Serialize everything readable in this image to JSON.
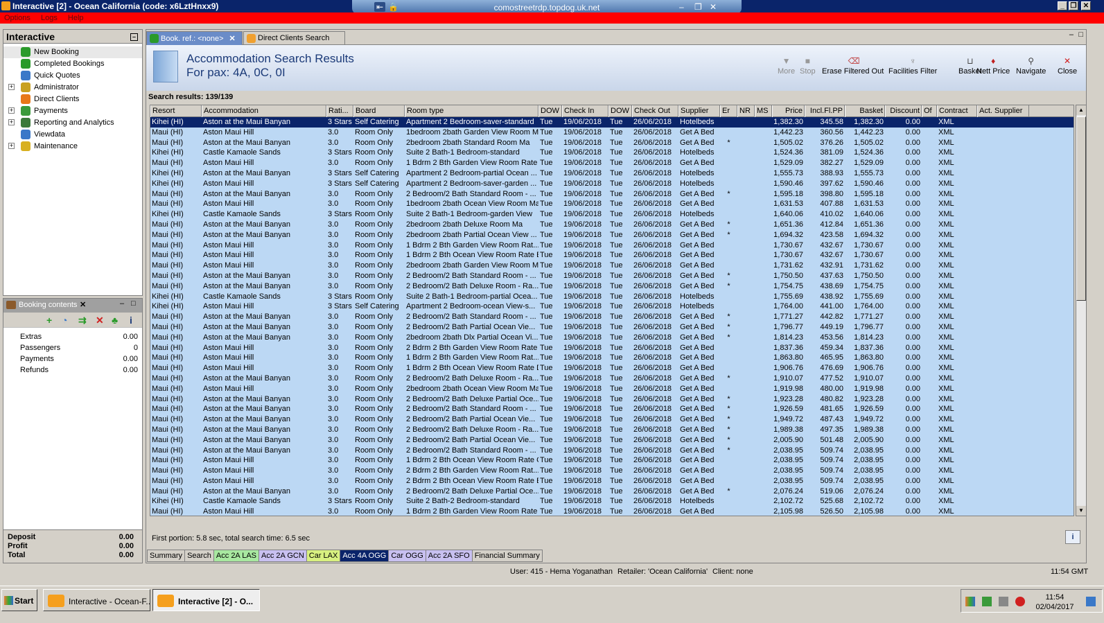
{
  "window": {
    "title": "Interactive [2] - Ocean California (code: x6LztHnxx9)",
    "remote_host": "comostreetrdp.topdog.uk.net"
  },
  "menu": [
    "Options",
    "Logs",
    "Help"
  ],
  "nav": {
    "title": "Interactive",
    "items": [
      {
        "label": "New Booking",
        "expandable": false,
        "icon": "palm-tree-icon",
        "color": "#2a9a2a"
      },
      {
        "label": "Completed Bookings",
        "expandable": false,
        "icon": "palm-tree-icon",
        "color": "#2a9a2a"
      },
      {
        "label": "Quick Quotes",
        "expandable": false,
        "icon": "clock-icon",
        "color": "#3a78c8"
      },
      {
        "label": "Administrator",
        "expandable": true,
        "icon": "person-icon",
        "color": "#c8a020"
      },
      {
        "label": "Direct Clients",
        "expandable": false,
        "icon": "star-icon",
        "color": "#e87818"
      },
      {
        "label": "Payments",
        "expandable": true,
        "icon": "payments-icon",
        "color": "#3a9a3a"
      },
      {
        "label": "Reporting and Analytics",
        "expandable": true,
        "icon": "report-icon",
        "color": "#3a7a3a"
      },
      {
        "label": "Viewdata",
        "expandable": false,
        "icon": "globe-icon",
        "color": "#3a78c8"
      },
      {
        "label": "Maintenance",
        "expandable": true,
        "icon": "toolbox-icon",
        "color": "#d8b020"
      }
    ]
  },
  "booking": {
    "title": "Booking contents",
    "rows": [
      {
        "label": "Extras",
        "value": "0.00"
      },
      {
        "label": "Passengers",
        "value": "0"
      },
      {
        "label": "Payments",
        "value": "0.00"
      },
      {
        "label": "Refunds",
        "value": "0.00"
      }
    ],
    "totals": [
      {
        "label": "Deposit",
        "value": "0.00"
      },
      {
        "label": "Profit",
        "value": "0.00"
      },
      {
        "label": "Total",
        "value": "0.00"
      }
    ]
  },
  "tabs": [
    {
      "label": "Book. ref.: <none>",
      "active": true
    },
    {
      "label": "Direct Clients Search",
      "active": false
    }
  ],
  "results": {
    "title": "Accommodation Search Results",
    "subtitle": "For pax: 4A, 0C, 0I",
    "count": "Search results: 139/139",
    "timing": "First portion: 5.8 sec, total search time: 6.5 sec"
  },
  "toolbar": [
    {
      "label": "More",
      "icon": "funnel-icon",
      "disabled": true
    },
    {
      "label": "Stop",
      "icon": "stop-icon",
      "disabled": true
    },
    {
      "label": "Erase Filtered Out",
      "icon": "erase-icon",
      "disabled": false
    },
    {
      "label": "Facilities Filter",
      "icon": "filter-icon",
      "disabled": false
    },
    {
      "label": "Basket",
      "icon": "basket-icon",
      "disabled": false
    },
    {
      "label": "Nett Price",
      "icon": "price-icon",
      "disabled": false
    },
    {
      "label": "Navigate",
      "icon": "navigate-icon",
      "disabled": false
    },
    {
      "label": "Close",
      "icon": "close-icon",
      "disabled": false
    }
  ],
  "columns": [
    "Resort",
    "Accommodation",
    "Rati...",
    "Board",
    "Room type",
    "DOW",
    "Check In",
    "DOW",
    "Check Out",
    "Supplier",
    "Er",
    "NR",
    "MS",
    "Price",
    "Incl.Fl.PP",
    "Basket",
    "Discount",
    "Of",
    "Contract",
    "Act. Supplier"
  ],
  "rows": [
    [
      "Kihei (HI)",
      "Aston at the Maui Banyan",
      "3 Stars",
      "Self Catering",
      "Apartment 2 Bedroom-saver-standard",
      "Tue",
      "19/06/2018",
      "Tue",
      "26/06/2018",
      "Hotelbeds",
      "",
      "",
      "",
      "1,382.30",
      "345.58",
      "1,382.30",
      "0.00",
      "",
      "XML",
      ""
    ],
    [
      "Maui (HI)",
      "Aston Maui Hill",
      "3.0",
      "Room Only",
      "1bedroom 2bath Garden View Room Ma",
      "Tue",
      "19/06/2018",
      "Tue",
      "26/06/2018",
      "Get A Bed",
      "",
      "",
      "",
      "1,442.23",
      "360.56",
      "1,442.23",
      "0.00",
      "",
      "XML",
      ""
    ],
    [
      "Maui (HI)",
      "Aston at the Maui Banyan",
      "3.0",
      "Room Only",
      "2bedroom 2bath Standard Room Ma",
      "Tue",
      "19/06/2018",
      "Tue",
      "26/06/2018",
      "Get A Bed",
      "*",
      "",
      "",
      "1,505.02",
      "376.26",
      "1,505.02",
      "0.00",
      "",
      "XML",
      ""
    ],
    [
      "Kihei (HI)",
      "Castle Kamaole Sands",
      "3 Stars",
      "Room Only",
      "Suite 2 Bath-1 Bedroom-standard",
      "Tue",
      "19/06/2018",
      "Tue",
      "26/06/2018",
      "Hotelbeds",
      "",
      "",
      "",
      "1,524.36",
      "381.09",
      "1,524.36",
      "0.00",
      "",
      "XML",
      ""
    ],
    [
      "Maui (HI)",
      "Aston Maui Hill",
      "3.0",
      "Room Only",
      "1 Bdrm 2 Bth Garden View Room Rate E",
      "Tue",
      "19/06/2018",
      "Tue",
      "26/06/2018",
      "Get A Bed",
      "",
      "",
      "",
      "1,529.09",
      "382.27",
      "1,529.09",
      "0.00",
      "",
      "XML",
      ""
    ],
    [
      "Kihei (HI)",
      "Aston at the Maui Banyan",
      "3 Stars",
      "Self Catering",
      "Apartment 2 Bedroom-partial Ocean ...",
      "Tue",
      "19/06/2018",
      "Tue",
      "26/06/2018",
      "Hotelbeds",
      "",
      "",
      "",
      "1,555.73",
      "388.93",
      "1,555.73",
      "0.00",
      "",
      "XML",
      ""
    ],
    [
      "Kihei (HI)",
      "Aston Maui Hill",
      "3 Stars",
      "Self Catering",
      "Apartment 2 Bedroom-saver-garden ...",
      "Tue",
      "19/06/2018",
      "Tue",
      "26/06/2018",
      "Hotelbeds",
      "",
      "",
      "",
      "1,590.46",
      "397.62",
      "1,590.46",
      "0.00",
      "",
      "XML",
      ""
    ],
    [
      "Maui (HI)",
      "Aston at the Maui Banyan",
      "3.0",
      "Room Only",
      "2 Bedroom/2 Bath Standard Room - ...",
      "Tue",
      "19/06/2018",
      "Tue",
      "26/06/2018",
      "Get A Bed",
      "*",
      "",
      "",
      "1,595.18",
      "398.80",
      "1,595.18",
      "0.00",
      "",
      "XML",
      ""
    ],
    [
      "Maui (HI)",
      "Aston Maui Hill",
      "3.0",
      "Room Only",
      "1bedroom 2bath Ocean View Room Ma",
      "Tue",
      "19/06/2018",
      "Tue",
      "26/06/2018",
      "Get A Bed",
      "",
      "",
      "",
      "1,631.53",
      "407.88",
      "1,631.53",
      "0.00",
      "",
      "XML",
      ""
    ],
    [
      "Kihei (HI)",
      "Castle Kamaole Sands",
      "3 Stars",
      "Room Only",
      "Suite 2 Bath-1 Bedroom-garden View",
      "Tue",
      "19/06/2018",
      "Tue",
      "26/06/2018",
      "Hotelbeds",
      "",
      "",
      "",
      "1,640.06",
      "410.02",
      "1,640.06",
      "0.00",
      "",
      "XML",
      ""
    ],
    [
      "Maui (HI)",
      "Aston at the Maui Banyan",
      "3.0",
      "Room Only",
      "2bedroom 2bath Deluxe  Room Ma",
      "Tue",
      "19/06/2018",
      "Tue",
      "26/06/2018",
      "Get A Bed",
      "*",
      "",
      "",
      "1,651.36",
      "412.84",
      "1,651.36",
      "0.00",
      "",
      "XML",
      ""
    ],
    [
      "Maui (HI)",
      "Aston at the Maui Banyan",
      "3.0",
      "Room Only",
      "2bedroom 2bath Partial Ocean View ...",
      "Tue",
      "19/06/2018",
      "Tue",
      "26/06/2018",
      "Get A Bed",
      "*",
      "",
      "",
      "1,694.32",
      "423.58",
      "1,694.32",
      "0.00",
      "",
      "XML",
      ""
    ],
    [
      "Maui (HI)",
      "Aston Maui Hill",
      "3.0",
      "Room Only",
      "1 Bdrm 2 Bth Garden View Room Rat...",
      "Tue",
      "19/06/2018",
      "Tue",
      "26/06/2018",
      "Get A Bed",
      "",
      "",
      "",
      "1,730.67",
      "432.67",
      "1,730.67",
      "0.00",
      "",
      "XML",
      ""
    ],
    [
      "Maui (HI)",
      "Aston Maui Hill",
      "3.0",
      "Room Only",
      "1 Bdrm 2 Bth Ocean View Room Rate E",
      "Tue",
      "19/06/2018",
      "Tue",
      "26/06/2018",
      "Get A Bed",
      "",
      "",
      "",
      "1,730.67",
      "432.67",
      "1,730.67",
      "0.00",
      "",
      "XML",
      ""
    ],
    [
      "Maui (HI)",
      "Aston Maui Hill",
      "3.0",
      "Room Only",
      "2bedroom 2bath Garden View Room Ma",
      "Tue",
      "19/06/2018",
      "Tue",
      "26/06/2018",
      "Get A Bed",
      "",
      "",
      "",
      "1,731.62",
      "432.91",
      "1,731.62",
      "0.00",
      "",
      "XML",
      ""
    ],
    [
      "Maui (HI)",
      "Aston at the Maui Banyan",
      "3.0",
      "Room Only",
      "2 Bedroom/2 Bath Standard Room - ...",
      "Tue",
      "19/06/2018",
      "Tue",
      "26/06/2018",
      "Get A Bed",
      "*",
      "",
      "",
      "1,750.50",
      "437.63",
      "1,750.50",
      "0.00",
      "",
      "XML",
      ""
    ],
    [
      "Maui (HI)",
      "Aston at the Maui Banyan",
      "3.0",
      "Room Only",
      "2 Bedroom/2 Bath Deluxe Room - Ra...",
      "Tue",
      "19/06/2018",
      "Tue",
      "26/06/2018",
      "Get A Bed",
      "*",
      "",
      "",
      "1,754.75",
      "438.69",
      "1,754.75",
      "0.00",
      "",
      "XML",
      ""
    ],
    [
      "Kihei (HI)",
      "Castle Kamaole Sands",
      "3 Stars",
      "Room Only",
      "Suite 2 Bath-1 Bedroom-partial Ocea...",
      "Tue",
      "19/06/2018",
      "Tue",
      "26/06/2018",
      "Hotelbeds",
      "",
      "",
      "",
      "1,755.69",
      "438.92",
      "1,755.69",
      "0.00",
      "",
      "XML",
      ""
    ],
    [
      "Kihei (HI)",
      "Aston Maui Hill",
      "3 Stars",
      "Self Catering",
      "Apartment 2 Bedroom-ocean View-s...",
      "Tue",
      "19/06/2018",
      "Tue",
      "26/06/2018",
      "Hotelbeds",
      "",
      "",
      "",
      "1,764.00",
      "441.00",
      "1,764.00",
      "0.00",
      "",
      "XML",
      ""
    ],
    [
      "Maui (HI)",
      "Aston at the Maui Banyan",
      "3.0",
      "Room Only",
      "2 Bedroom/2 Bath Standard Room - ...",
      "Tue",
      "19/06/2018",
      "Tue",
      "26/06/2018",
      "Get A Bed",
      "*",
      "",
      "",
      "1,771.27",
      "442.82",
      "1,771.27",
      "0.00",
      "",
      "XML",
      ""
    ],
    [
      "Maui (HI)",
      "Aston at the Maui Banyan",
      "3.0",
      "Room Only",
      "2 Bedroom/2 Bath Partial Ocean Vie...",
      "Tue",
      "19/06/2018",
      "Tue",
      "26/06/2018",
      "Get A Bed",
      "*",
      "",
      "",
      "1,796.77",
      "449.19",
      "1,796.77",
      "0.00",
      "",
      "XML",
      ""
    ],
    [
      "Maui (HI)",
      "Aston at the Maui Banyan",
      "3.0",
      "Room Only",
      "2bedroom 2bath Dlx Partial Ocean Vi...",
      "Tue",
      "19/06/2018",
      "Tue",
      "26/06/2018",
      "Get A Bed",
      "*",
      "",
      "",
      "1,814.23",
      "453.56",
      "1,814.23",
      "0.00",
      "",
      "XML",
      ""
    ],
    [
      "Maui (HI)",
      "Aston Maui Hill",
      "3.0",
      "Room Only",
      "2 Bdrm 2 Bth Garden View Room Rate E",
      "Tue",
      "19/06/2018",
      "Tue",
      "26/06/2018",
      "Get A Bed",
      "",
      "",
      "",
      "1,837.36",
      "459.34",
      "1,837.36",
      "0.00",
      "",
      "XML",
      ""
    ],
    [
      "Maui (HI)",
      "Aston Maui Hill",
      "3.0",
      "Room Only",
      "1 Bdrm 2 Bth Garden View Room Rat...",
      "Tue",
      "19/06/2018",
      "Tue",
      "26/06/2018",
      "Get A Bed",
      "",
      "",
      "",
      "1,863.80",
      "465.95",
      "1,863.80",
      "0.00",
      "",
      "XML",
      ""
    ],
    [
      "Maui (HI)",
      "Aston Maui Hill",
      "3.0",
      "Room Only",
      "1 Bdrm 2 Bth Ocean View Room Rate D",
      "Tue",
      "19/06/2018",
      "Tue",
      "26/06/2018",
      "Get A Bed",
      "",
      "",
      "",
      "1,906.76",
      "476.69",
      "1,906.76",
      "0.00",
      "",
      "XML",
      ""
    ],
    [
      "Maui (HI)",
      "Aston at the Maui Banyan",
      "3.0",
      "Room Only",
      "2 Bedroom/2 Bath Deluxe Room - Ra...",
      "Tue",
      "19/06/2018",
      "Tue",
      "26/06/2018",
      "Get A Bed",
      "*",
      "",
      "",
      "1,910.07",
      "477.52",
      "1,910.07",
      "0.00",
      "",
      "XML",
      ""
    ],
    [
      "Maui (HI)",
      "Aston Maui Hill",
      "3.0",
      "Room Only",
      "2bedroom 2bath Ocean View Room Ma",
      "Tue",
      "19/06/2018",
      "Tue",
      "26/06/2018",
      "Get A Bed",
      "",
      "",
      "",
      "1,919.98",
      "480.00",
      "1,919.98",
      "0.00",
      "",
      "XML",
      ""
    ],
    [
      "Maui (HI)",
      "Aston at the Maui Banyan",
      "3.0",
      "Room Only",
      "2 Bedroom/2 Bath Deluxe Partial Oce...",
      "Tue",
      "19/06/2018",
      "Tue",
      "26/06/2018",
      "Get A Bed",
      "*",
      "",
      "",
      "1,923.28",
      "480.82",
      "1,923.28",
      "0.00",
      "",
      "XML",
      ""
    ],
    [
      "Maui (HI)",
      "Aston at the Maui Banyan",
      "3.0",
      "Room Only",
      "2 Bedroom/2 Bath Standard Room - ...",
      "Tue",
      "19/06/2018",
      "Tue",
      "26/06/2018",
      "Get A Bed",
      "*",
      "",
      "",
      "1,926.59",
      "481.65",
      "1,926.59",
      "0.00",
      "",
      "XML",
      ""
    ],
    [
      "Maui (HI)",
      "Aston at the Maui Banyan",
      "3.0",
      "Room Only",
      "2 Bedroom/2 Bath Partial Ocean Vie...",
      "Tue",
      "19/06/2018",
      "Tue",
      "26/06/2018",
      "Get A Bed",
      "*",
      "",
      "",
      "1,949.72",
      "487.43",
      "1,949.72",
      "0.00",
      "",
      "XML",
      ""
    ],
    [
      "Maui (HI)",
      "Aston at the Maui Banyan",
      "3.0",
      "Room Only",
      "2 Bedroom/2 Bath Deluxe Room - Ra...",
      "Tue",
      "19/06/2018",
      "Tue",
      "26/06/2018",
      "Get A Bed",
      "*",
      "",
      "",
      "1,989.38",
      "497.35",
      "1,989.38",
      "0.00",
      "",
      "XML",
      ""
    ],
    [
      "Maui (HI)",
      "Aston at the Maui Banyan",
      "3.0",
      "Room Only",
      "2 Bedroom/2 Bath Partial Ocean Vie...",
      "Tue",
      "19/06/2018",
      "Tue",
      "26/06/2018",
      "Get A Bed",
      "*",
      "",
      "",
      "2,005.90",
      "501.48",
      "2,005.90",
      "0.00",
      "",
      "XML",
      ""
    ],
    [
      "Maui (HI)",
      "Aston at the Maui Banyan",
      "3.0",
      "Room Only",
      "2 Bedroom/2 Bath Standard Room - ...",
      "Tue",
      "19/06/2018",
      "Tue",
      "26/06/2018",
      "Get A Bed",
      "*",
      "",
      "",
      "2,038.95",
      "509.74",
      "2,038.95",
      "0.00",
      "",
      "XML",
      ""
    ],
    [
      "Maui (HI)",
      "Aston Maui Hill",
      "3.0",
      "Room Only",
      "1 Bdrm 2 Bth Ocean View Room Rate C",
      "Tue",
      "19/06/2018",
      "Tue",
      "26/06/2018",
      "Get A Bed",
      "",
      "",
      "",
      "2,038.95",
      "509.74",
      "2,038.95",
      "0.00",
      "",
      "XML",
      ""
    ],
    [
      "Maui (HI)",
      "Aston Maui Hill",
      "3.0",
      "Room Only",
      "2 Bdrm 2 Bth Garden View Room Rat...",
      "Tue",
      "19/06/2018",
      "Tue",
      "26/06/2018",
      "Get A Bed",
      "",
      "",
      "",
      "2,038.95",
      "509.74",
      "2,038.95",
      "0.00",
      "",
      "XML",
      ""
    ],
    [
      "Maui (HI)",
      "Aston Maui Hill",
      "3.0",
      "Room Only",
      "2 Bdrm 2 Bth Ocean View Room Rate E",
      "Tue",
      "19/06/2018",
      "Tue",
      "26/06/2018",
      "Get A Bed",
      "",
      "",
      "",
      "2,038.95",
      "509.74",
      "2,038.95",
      "0.00",
      "",
      "XML",
      ""
    ],
    [
      "Maui (HI)",
      "Aston at the Maui Banyan",
      "3.0",
      "Room Only",
      "2 Bedroom/2 Bath Deluxe Partial Oce...",
      "Tue",
      "19/06/2018",
      "Tue",
      "26/06/2018",
      "Get A Bed",
      "*",
      "",
      "",
      "2,076.24",
      "519.06",
      "2,076.24",
      "0.00",
      "",
      "XML",
      ""
    ],
    [
      "Kihei (HI)",
      "Castle Kamaole Sands",
      "3 Stars",
      "Room Only",
      "Suite 2 Bath-2 Bedroom-standard",
      "Tue",
      "19/06/2018",
      "Tue",
      "26/06/2018",
      "Hotelbeds",
      "",
      "",
      "",
      "2,102.72",
      "525.68",
      "2,102.72",
      "0.00",
      "",
      "XML",
      ""
    ],
    [
      "Maui (HI)",
      "Aston Maui Hill",
      "3.0",
      "Room Only",
      "1 Bdrm 2 Bth Garden View Room Rate B",
      "Tue",
      "19/06/2018",
      "Tue",
      "26/06/2018",
      "Get A Bed",
      "",
      "",
      "",
      "2,105.98",
      "526.50",
      "2,105.98",
      "0.00",
      "",
      "XML",
      ""
    ]
  ],
  "bottom_tabs": [
    {
      "label": "Summary",
      "bg": "#d4d0c8",
      "fg": "#000000"
    },
    {
      "label": "Search",
      "bg": "#d4d0c8",
      "fg": "#000000"
    },
    {
      "label": "Acc 2A LAS",
      "bg": "#a8e8a0",
      "fg": "#000000"
    },
    {
      "label": "Acc 2A GCN",
      "bg": "#c8c0f0",
      "fg": "#000000"
    },
    {
      "label": "Car LAX",
      "bg": "#d8f080",
      "fg": "#000000"
    },
    {
      "label": "Acc 4A OGG",
      "bg": "#0a246a",
      "fg": "#ffffff"
    },
    {
      "label": "Car OGG",
      "bg": "#c8c0f0",
      "fg": "#000000"
    },
    {
      "label": "Acc 2A SFO",
      "bg": "#c8c0f0",
      "fg": "#000000"
    },
    {
      "label": "Financial Summary",
      "bg": "#d4d0c8",
      "fg": "#000000"
    }
  ],
  "status": {
    "user": "User: 415 - Hema Yoganathan",
    "retailer": "Retailer: 'Ocean California'",
    "client": "Client: none",
    "time": "11:54 GMT"
  },
  "taskbar": {
    "start": "Start",
    "tasks": [
      "Interactive - Ocean-F...",
      "Interactive [2] - O..."
    ],
    "clock_time": "11:54",
    "clock_date": "02/04/2017"
  }
}
